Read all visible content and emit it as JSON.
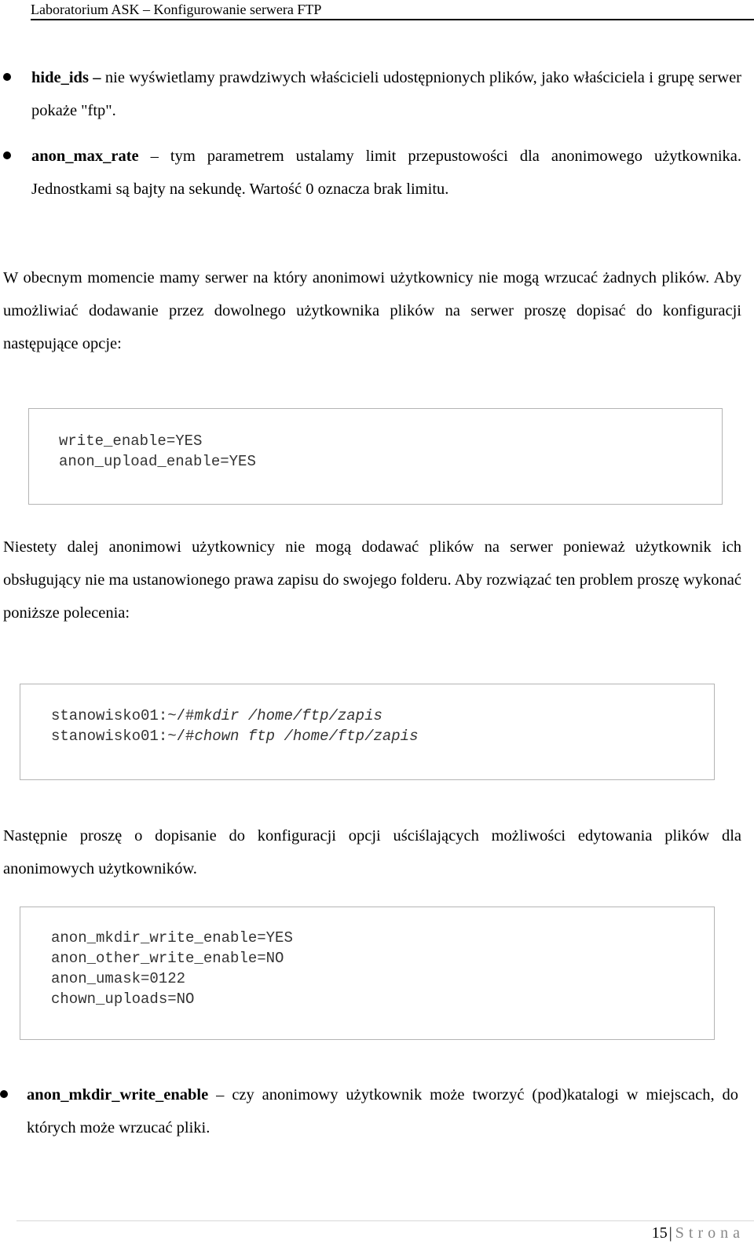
{
  "header": {
    "title": "Laboratorium ASK – Konfigurowanie serwera FTP"
  },
  "bullets_top": [
    {
      "term": "hide_ids",
      "dash": " – ",
      "description": "nie wyświetlamy prawdziwych właścicieli udostępnionych plików, jako właściciela i grupę serwer pokaże \"ftp\"."
    },
    {
      "term": "anon_max_rate",
      "dash": " – ",
      "description": "tym parametrem ustalamy limit przepustowości dla anonimowego użytkownika. Jednostkami są bajty na sekundę. Wartość 0 oznacza brak limitu."
    }
  ],
  "paragraphs": {
    "intro_upload": "W obecnym momencie mamy serwer na który anonimowi użytkownicy nie mogą wrzucać żadnych plików. Aby umożliwiać dodawanie przez dowolnego użytkownika plików na serwer proszę dopisać do konfiguracji następujące opcje:",
    "permissions_problem": "Niestety dalej anonimowi użytkownicy nie mogą dodawać plików na serwer ponieważ użytkownik ich obsługujący nie ma ustanowionego prawa zapisu do swojego folderu. Aby rozwiązać ten problem proszę wykonać poniższe polecenia:",
    "restrict_options": "Następnie proszę o dopisanie do konfiguracji opcji uściślających możliwości edytowania plików dla anonimowych użytkowników."
  },
  "code_blocks": {
    "upload_config": [
      "write_enable=YES",
      "anon_upload_enable=YES"
    ],
    "shell_commands": [
      {
        "prompt": "stanowisko01:~/#",
        "command": "mkdir /home/ftp/zapis"
      },
      {
        "prompt": "stanowisko01:~/#",
        "command": "chown ftp /home/ftp/zapis"
      }
    ],
    "restrict_config": [
      "anon_mkdir_write_enable=YES",
      "anon_other_write_enable=NO",
      "anon_umask=0122",
      "chown_uploads=NO"
    ]
  },
  "bullets_bottom": [
    {
      "term": "anon_mkdir_write_enable",
      "dash": " – ",
      "description": "czy anonimowy użytkownik może tworzyć (pod)katalogi w miejscach, do których może wrzucać pliki."
    }
  ],
  "footer": {
    "page_number": "15",
    "separator": "|",
    "page_word": "Strona"
  },
  "colors": {
    "text": "#000000",
    "code_text": "#333333",
    "code_border": "#b4b4b4",
    "footer_word": "#888888"
  }
}
